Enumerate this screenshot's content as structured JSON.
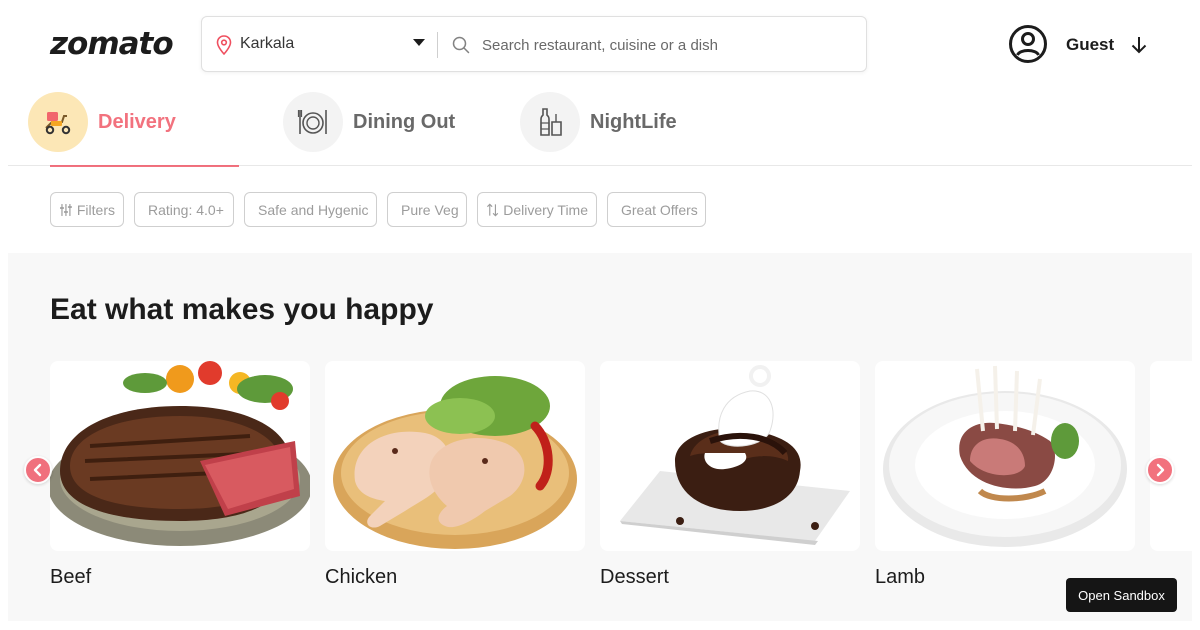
{
  "header": {
    "logo": "zomato",
    "location": "Karkala",
    "search_placeholder": "Search restaurant, cuisine or a dish",
    "user_name": "Guest"
  },
  "tabs": [
    {
      "label": "Delivery",
      "active": true,
      "icon": "scooter-icon"
    },
    {
      "label": "Dining Out",
      "active": false,
      "icon": "dining-plate-icon"
    },
    {
      "label": "NightLife",
      "active": false,
      "icon": "bottle-glass-icon"
    }
  ],
  "filters": [
    {
      "label": "Filters",
      "icon": "sliders-icon"
    },
    {
      "label": "Rating: 4.0+"
    },
    {
      "label": "Safe and Hygenic"
    },
    {
      "label": "Pure Veg"
    },
    {
      "label": "Delivery Time",
      "icon": "sort-arrows-icon"
    },
    {
      "label": "Great Offers"
    }
  ],
  "collections": {
    "title": "Eat what makes you happy",
    "items": [
      {
        "label": "Beef"
      },
      {
        "label": "Chicken"
      },
      {
        "label": "Dessert"
      },
      {
        "label": "Lamb"
      }
    ]
  },
  "sandbox_button": "Open Sandbox",
  "colors": {
    "brand": "#ef4f5f",
    "active_icon_bg": "#fce7b6",
    "text_dark": "#1c1c1c",
    "text_muted": "#696969"
  }
}
